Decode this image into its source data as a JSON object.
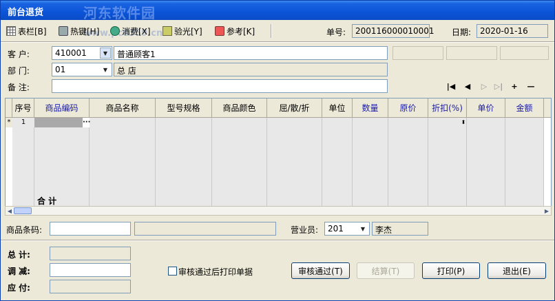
{
  "window": {
    "title": "前台退货",
    "watermark": "河东软件园",
    "watermark_url": "www.pc0359.cn"
  },
  "toolbar": {
    "buttons": [
      {
        "label": "表栏[B]",
        "icon": "table-icon"
      },
      {
        "label": "热键[H]",
        "icon": "keyboard-icon"
      },
      {
        "label": "消费[X]",
        "icon": "cash-icon"
      },
      {
        "label": "验光[Y]",
        "icon": "verify-icon"
      },
      {
        "label": "参考[K]",
        "icon": "reference-icon"
      }
    ],
    "order_no_label": "单号:",
    "order_no": "200116000010001",
    "date_label": "日期:",
    "date": "2020-01-16"
  },
  "form": {
    "customer_label": "客    户:",
    "customer_code": "410001",
    "customer_name": "普通顾客1",
    "dept_label": "部    门:",
    "dept_code": "01",
    "dept_name": "总  店",
    "note_label": "备    注:",
    "note": ""
  },
  "nav": [
    "|◀",
    "◀",
    "▷",
    "▷|",
    "+",
    "—"
  ],
  "grid": {
    "columns": [
      "序号",
      "商品编码",
      "商品名称",
      "型号规格",
      "商品颜色",
      "屈/散/折",
      "单位",
      "数量",
      "原价",
      "折扣(%)",
      "单价",
      "金额"
    ],
    "row_indicator": "*",
    "first_row_index": "1",
    "total_label": "合  计"
  },
  "barcode": {
    "label": "商品条码:",
    "value": "",
    "clerk_label": "营业员:",
    "clerk_code": "201",
    "clerk_name": "李杰"
  },
  "totals": {
    "total_label": "总    计:",
    "adjust_label": "调    减:",
    "payable_label": "应    付:"
  },
  "options": {
    "print_after_audit": "审核通过后打印单据"
  },
  "actions": {
    "audit": "审核通过(T)",
    "settle": "结算(T)",
    "print": "打印(P)",
    "exit": "退出(E)"
  }
}
